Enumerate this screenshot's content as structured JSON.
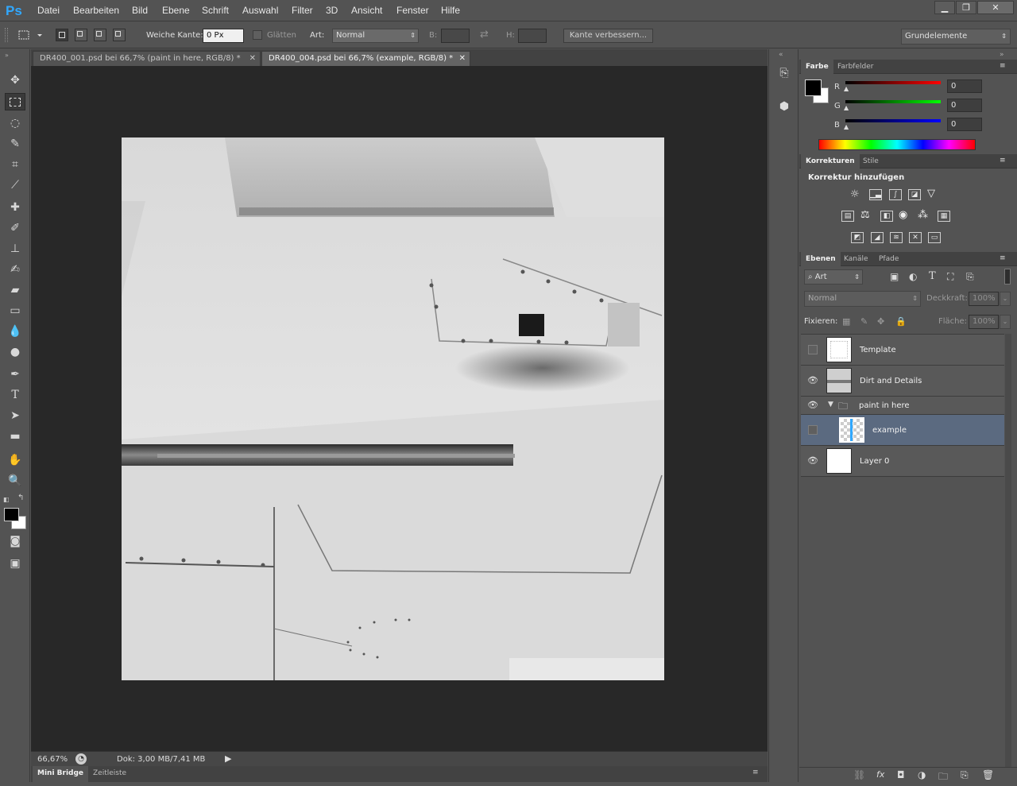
{
  "app": {
    "logo": "Ps"
  },
  "menu": [
    "Datei",
    "Bearbeiten",
    "Bild",
    "Ebene",
    "Schrift",
    "Auswahl",
    "Filter",
    "3D",
    "Ansicht",
    "Fenster",
    "Hilfe"
  ],
  "window_buttons": {
    "minimize": "▁",
    "restore": "❐",
    "close": "✕"
  },
  "options": {
    "feather_label": "Weiche Kante:",
    "feather_value": "0 Px",
    "smooth_label": "Glätten",
    "style_label": "Art:",
    "style_value": "Normal",
    "width_label": "B:",
    "height_label": "H:",
    "refine_button": "Kante verbessern...",
    "workspace": "Grundelemente"
  },
  "tabs": [
    {
      "label": "DR400_001.psd bei 66,7% (paint in here, RGB/8) *",
      "close": "✕"
    },
    {
      "label": "DR400_004.psd bei 66,7% (example, RGB/8) *",
      "close": "✕"
    }
  ],
  "status": {
    "zoom": "66,67%",
    "doc": "Dok: 3,00 MB/7,41 MB"
  },
  "bottom_tabs": [
    "Mini Bridge",
    "Zeitleiste"
  ],
  "color_panel": {
    "tabs": [
      "Farbe",
      "Farbfelder"
    ],
    "channels": [
      {
        "label": "R",
        "value": "0",
        "color": "#ff0000"
      },
      {
        "label": "G",
        "value": "0",
        "color": "#00ff00"
      },
      {
        "label": "B",
        "value": "0",
        "color": "#0000ff"
      }
    ]
  },
  "adjustments_panel": {
    "tabs": [
      "Korrekturen",
      "Stile"
    ],
    "title": "Korrektur hinzufügen"
  },
  "layers_panel": {
    "tabs": [
      "Ebenen",
      "Kanäle",
      "Pfade"
    ],
    "filter_kind": "Art",
    "blend_mode": "Normal",
    "opacity_label": "Deckkraft:",
    "opacity_value": "100%",
    "lock_label": "Fixieren:",
    "fill_label": "Fläche:",
    "fill_value": "100%",
    "layers": [
      {
        "name": "Template",
        "visible": false
      },
      {
        "name": "Dirt and Details",
        "visible": true
      },
      {
        "name": "paint in here",
        "visible": true,
        "group": true
      },
      {
        "name": "example",
        "visible": false,
        "selected": true
      },
      {
        "name": "Layer 0",
        "visible": true
      }
    ]
  },
  "colors": {
    "accent": "#31a8ff",
    "canvas_bg": "#282828",
    "ui_bg": "#535353",
    "selected_layer": "#5b6a80"
  }
}
